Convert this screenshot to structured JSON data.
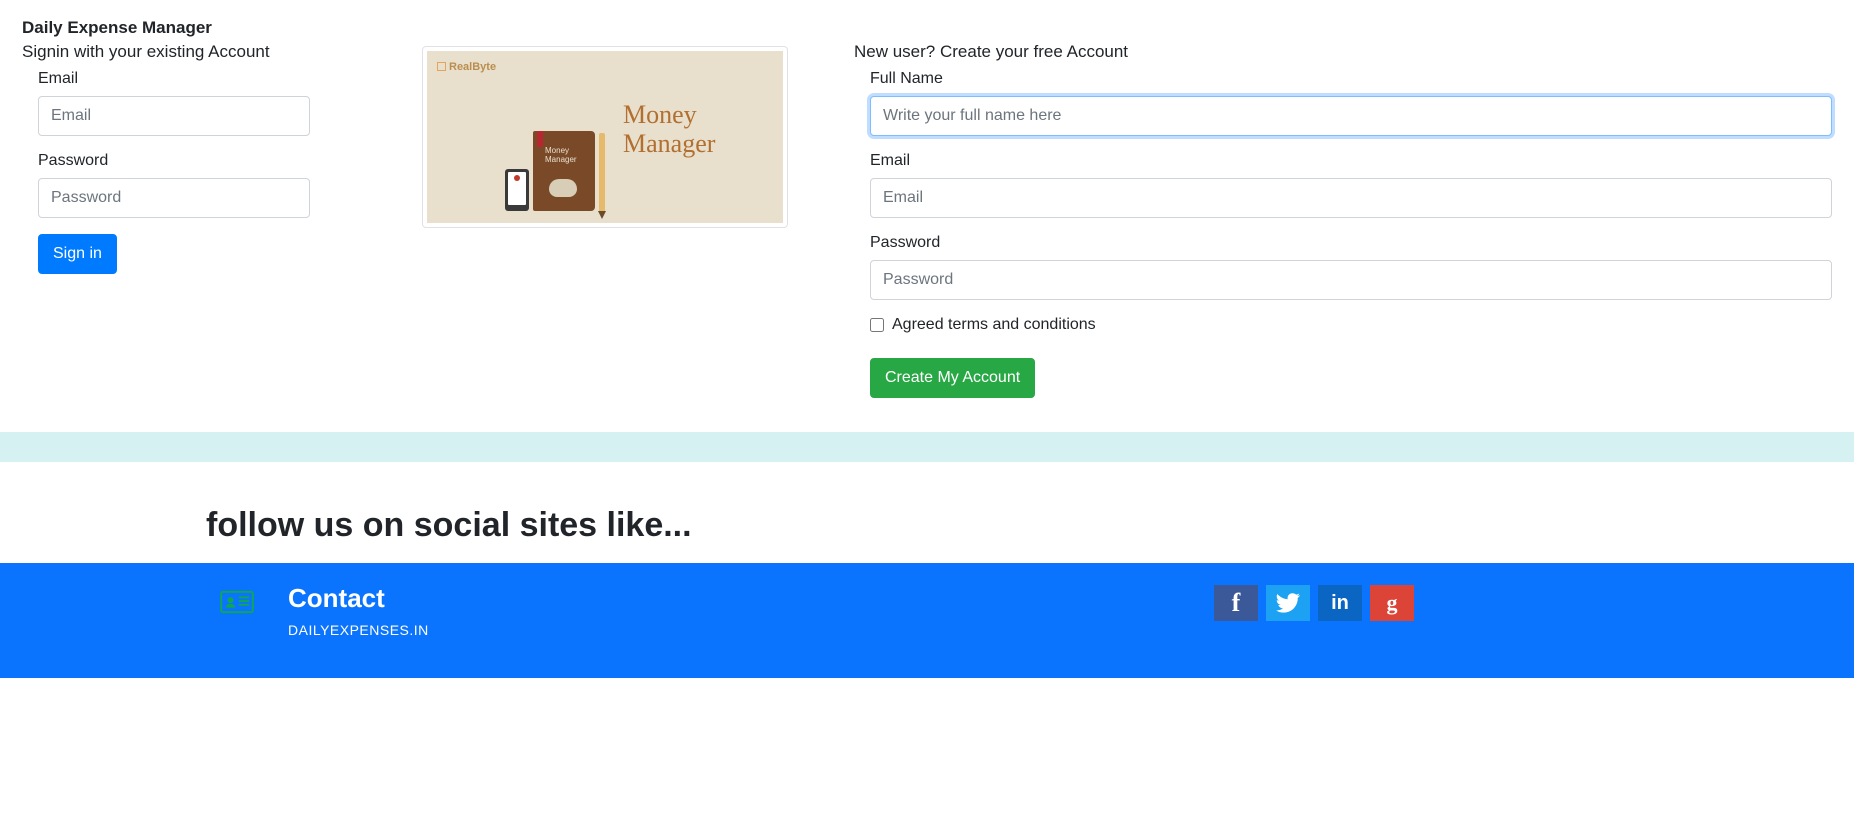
{
  "app_title": "Daily Expense Manager",
  "signin": {
    "heading": "Signin with your existing Account",
    "email_label": "Email",
    "email_placeholder": "Email",
    "password_label": "Password",
    "password_placeholder": "Password",
    "submit_label": "Sign in"
  },
  "promo": {
    "brand": "RealByte",
    "book_label": "Money\nManager",
    "headline_line1": "Money",
    "headline_line2": "Manager"
  },
  "signup": {
    "heading": "New user? Create your free Account",
    "fullname_label": "Full Name",
    "fullname_placeholder": "Write your full name here",
    "email_label": "Email",
    "email_placeholder": "Email",
    "password_label": "Password",
    "password_placeholder": "Password",
    "terms_label": "Agreed terms and conditions",
    "submit_label": "Create My Account"
  },
  "follow_heading": "follow us on social sites like...",
  "footer": {
    "contact_title": "Contact",
    "contact_sub": "DAILYEXPENSES.IN"
  },
  "social": {
    "facebook": "f",
    "linkedin": "in",
    "google": "g"
  }
}
